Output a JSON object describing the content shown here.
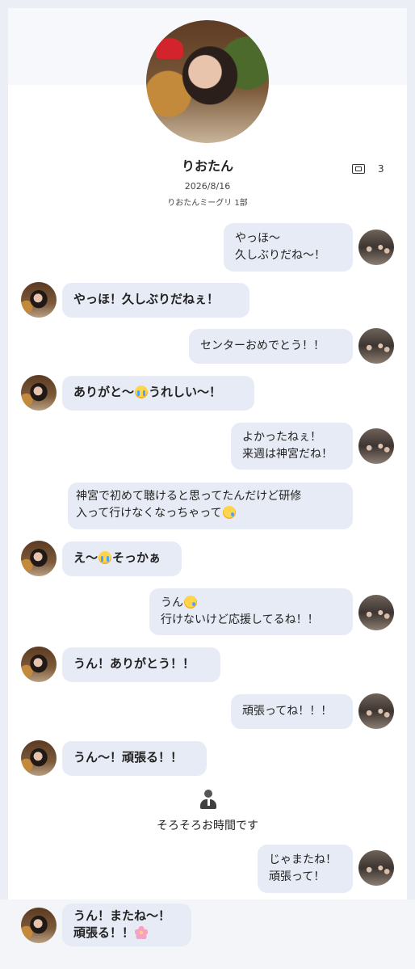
{
  "header": {
    "name": "りおたん",
    "date": "2026/8/16",
    "group": "りおたんミーグリ 1部",
    "ticket_count": "3"
  },
  "messages": [
    {
      "from": "me",
      "lines": [
        "やっほ〜",
        "久しぶりだね〜！"
      ]
    },
    {
      "from": "her",
      "lines": [
        "やっほ！久しぶりだねぇ！"
      ]
    },
    {
      "from": "me",
      "lines": [
        "センターおめでとう！！"
      ]
    },
    {
      "from": "her",
      "parts": [
        "ありがと〜",
        "うれしい〜！"
      ],
      "emoji": "loudly-crying-face"
    },
    {
      "from": "me",
      "lines": [
        "よかったねぇ！",
        "来週は神宮だね！"
      ]
    },
    {
      "from": "her",
      "lines": [
        "神宮で初めて聴けると思ってたんだけど研修",
        "入って行けなくなっちゃって"
      ],
      "emoji": "crying-face"
    },
    {
      "from": "her",
      "parts": [
        "え〜",
        "そっかぁ"
      ],
      "emoji": "loudly-crying-face"
    },
    {
      "from": "me",
      "lines": [
        "うん",
        "行けないけど応援してるね！！"
      ],
      "emoji": "crying-face"
    },
    {
      "from": "her",
      "lines": [
        "うん！ありがとう！！"
      ]
    },
    {
      "from": "me",
      "lines": [
        "頑張ってね！！！"
      ]
    },
    {
      "from": "her",
      "lines": [
        "うん〜！頑張る！！"
      ]
    },
    {
      "from": "me",
      "lines": [
        "じゃまたね！",
        "頑張って！"
      ]
    },
    {
      "from": "her",
      "lines": [
        "うん！またね〜！",
        "頑張る！！"
      ],
      "emoji": "cherry-blossom"
    }
  ],
  "system": {
    "icon": "staff-person-icon",
    "text": "そろそろお時間です"
  },
  "colors": {
    "bubble": "#e7ebf5",
    "background": "#eceef5"
  }
}
